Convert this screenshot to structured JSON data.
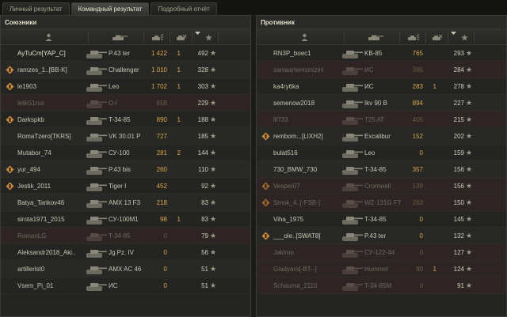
{
  "tabs": [
    {
      "label": "Личный результат",
      "active": false
    },
    {
      "label": "Командный результат",
      "active": true
    },
    {
      "label": "Подробный отчёт",
      "active": false
    }
  ],
  "allies": {
    "title": "Союзники",
    "rows": [
      {
        "player": "AyTuCm[YAP_C]",
        "vehicle": "P.43 ter",
        "damage": "1 422",
        "kills": "1",
        "xp": "492",
        "platoon": false,
        "dead": false,
        "highlight": true
      },
      {
        "player": "ramzes_1..[BB-K]",
        "vehicle": "Challenger",
        "damage": "1 010",
        "kills": "1",
        "xp": "328",
        "platoon": true,
        "dead": false
      },
      {
        "player": "le1903",
        "vehicle": "Leo",
        "damage": "1 702",
        "kills": "1",
        "xp": "303",
        "platoon": true,
        "dead": false
      },
      {
        "player": "lelik51rus",
        "vehicle": "O-I",
        "damage": "658",
        "kills": "",
        "xp": "229",
        "platoon": false,
        "dead": true
      },
      {
        "player": "Darkspkb",
        "vehicle": "T-34-85",
        "damage": "890",
        "kills": "1",
        "xp": "188",
        "platoon": true,
        "dead": false
      },
      {
        "player": "RomaTzero[TKRS]",
        "vehicle": "VK 30.01 P",
        "damage": "727",
        "kills": "",
        "xp": "185",
        "platoon": false,
        "dead": false
      },
      {
        "player": "Mutabor_74",
        "vehicle": "СУ-100",
        "damage": "281",
        "kills": "2",
        "xp": "144",
        "platoon": false,
        "dead": false
      },
      {
        "player": "yur_494",
        "vehicle": "P.43 bis",
        "damage": "260",
        "kills": "",
        "xp": "110",
        "platoon": true,
        "dead": false
      },
      {
        "player": "Jestik_2011",
        "vehicle": "Tiger I",
        "damage": "452",
        "kills": "",
        "xp": "92",
        "platoon": true,
        "dead": false
      },
      {
        "player": "Batya_Tankov46",
        "vehicle": "AMX 13 F3",
        "damage": "218",
        "kills": "",
        "xp": "83",
        "platoon": false,
        "dead": false
      },
      {
        "player": "sirota1971_2015",
        "vehicle": "СУ-100М1",
        "damage": "98",
        "kills": "1",
        "xp": "83",
        "platoon": false,
        "dead": false
      },
      {
        "player": "RomanLG",
        "vehicle": "T-34-85",
        "damage": "0",
        "kills": "",
        "xp": "79",
        "platoon": false,
        "dead": true
      },
      {
        "player": "Aleksandr2018_Aki..",
        "vehicle": "Jg.Pz. IV",
        "damage": "0",
        "kills": "",
        "xp": "56",
        "platoon": false,
        "dead": false
      },
      {
        "player": "artillerist0",
        "vehicle": "AMX AC 46",
        "damage": "0",
        "kills": "",
        "xp": "51",
        "platoon": false,
        "dead": false
      },
      {
        "player": "Vsem_Pi_01",
        "vehicle": "ИС",
        "damage": "0",
        "kills": "",
        "xp": "51",
        "platoon": false,
        "dead": false
      }
    ]
  },
  "enemies": {
    "title": "Противник",
    "rows": [
      {
        "player": "RN3P_boec1",
        "vehicle": "KB-85",
        "damage": "765",
        "kills": "",
        "xp": "293",
        "platoon": false,
        "dead": false
      },
      {
        "player": "saniaartemsinizini",
        "vehicle": "ИС",
        "damage": "385",
        "kills": "",
        "xp": "284",
        "platoon": false,
        "dead": true
      },
      {
        "player": "ka4ry6ka",
        "vehicle": "ИС",
        "damage": "283",
        "kills": "1",
        "xp": "278",
        "platoon": false,
        "dead": false
      },
      {
        "player": "semenow2018",
        "vehicle": "Ikv 90 B",
        "damage": "894",
        "kills": "",
        "xp": "227",
        "platoon": false,
        "dead": false
      },
      {
        "player": "lll733",
        "vehicle": "T25 AT",
        "damage": "405",
        "kills": "",
        "xp": "215",
        "platoon": false,
        "dead": true
      },
      {
        "player": "rembom...[LIXH2]",
        "vehicle": "Excalibur",
        "damage": "152",
        "kills": "",
        "xp": "202",
        "platoon": true,
        "dead": false
      },
      {
        "player": "bulat516",
        "vehicle": "Leo",
        "damage": "0",
        "kills": "",
        "xp": "159",
        "platoon": false,
        "dead": false
      },
      {
        "player": "730_BMW_730",
        "vehicle": "T-34-85",
        "damage": "357",
        "kills": "",
        "xp": "156",
        "platoon": false,
        "dead": false
      },
      {
        "player": "Vesper07",
        "vehicle": "Cromwell",
        "damage": "139",
        "kills": "",
        "xp": "156",
        "platoon": true,
        "dead": true
      },
      {
        "player": "Smok_4..[-FSB-]",
        "vehicle": "WZ-131G FT",
        "damage": "263",
        "kills": "",
        "xp": "150",
        "platoon": true,
        "dead": true
      },
      {
        "player": "Viha_1975",
        "vehicle": "T-34-85",
        "damage": "0",
        "kills": "",
        "xp": "145",
        "platoon": false,
        "dead": false
      },
      {
        "player": "___ole..[SWAT8]",
        "vehicle": "P.43 ter",
        "damage": "0",
        "kills": "",
        "xp": "132",
        "platoon": true,
        "dead": false
      },
      {
        "player": "Jakiroo",
        "vehicle": "СУ-122-44",
        "damage": "0",
        "kills": "",
        "xp": "127",
        "platoon": false,
        "dead": true
      },
      {
        "player": "Gladyara[-BT--]",
        "vehicle": "Hummel",
        "damage": "80",
        "kills": "1",
        "xp": "124",
        "platoon": false,
        "dead": true
      },
      {
        "player": "Schauma_2110",
        "vehicle": "T-34-85M",
        "damage": "0",
        "kills": "",
        "xp": "91",
        "platoon": false,
        "dead": true
      }
    ]
  },
  "column_icons": [
    "player-icon",
    "vehicle-icon",
    "damage-icon",
    "kills-icon",
    "sort-arrow-icon",
    "xp-star-icon"
  ],
  "colors": {
    "damage": "#d8a64b",
    "dead_row": "#2e2423",
    "active_tab": "#4a4b46"
  }
}
